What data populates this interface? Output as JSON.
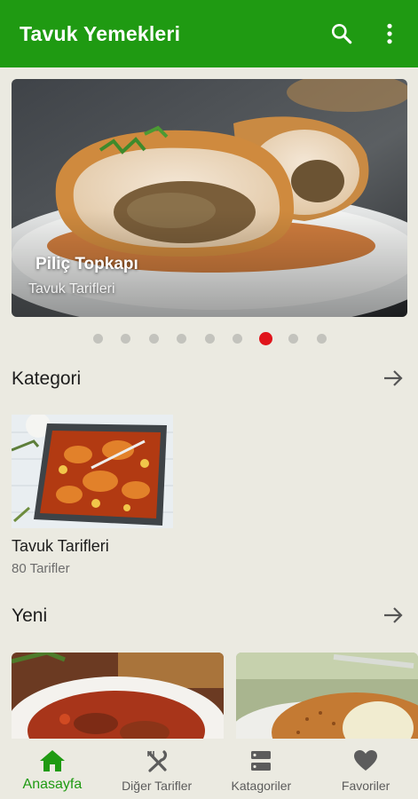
{
  "colors": {
    "primary": "#1f9a12",
    "background": "#ebeae1",
    "active_dot": "#e0141b",
    "inactive_dot": "#c3c3bd"
  },
  "app_bar": {
    "title": "Tavuk Yemekleri",
    "search_icon": "search-icon",
    "menu_icon": "more-vert-icon"
  },
  "slider": {
    "title": "Piliç Topkapı",
    "subtitle": "Tavuk Tarifleri",
    "page_count": 9,
    "active_index": 6
  },
  "categories": {
    "heading": "Kategori",
    "items": [
      {
        "name": "Tavuk Tarifleri",
        "count": "80 Tarifler"
      }
    ]
  },
  "new_section": {
    "heading": "Yeni"
  },
  "bottom_nav": {
    "items": [
      {
        "label": "Anasayfa",
        "icon": "home-icon",
        "active": true
      },
      {
        "label": "Diğer Tarifler",
        "icon": "utensils-icon",
        "active": false
      },
      {
        "label": "Katagoriler",
        "icon": "list-icon",
        "active": false
      },
      {
        "label": "Favoriler",
        "icon": "heart-icon",
        "active": false
      }
    ]
  }
}
